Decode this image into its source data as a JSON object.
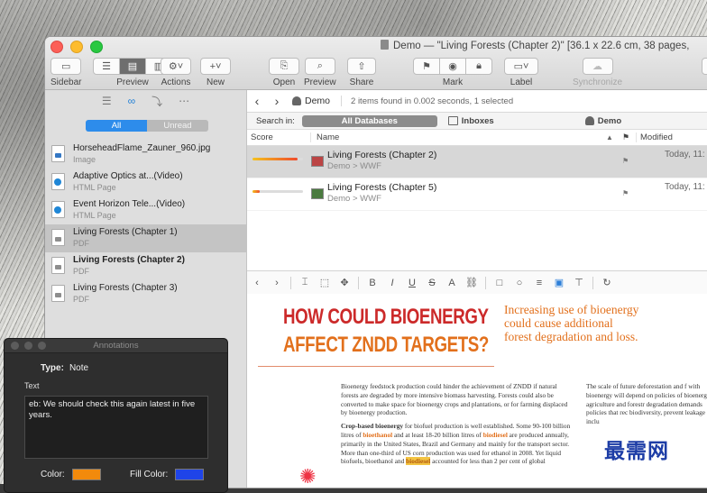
{
  "window": {
    "title": "Demo — \"Living Forests (Chapter 2)\" [36.1 x 22.6 cm, 38 pages,",
    "colors": {
      "accent": "#2d8ceb"
    }
  },
  "toolbar": {
    "sidebar": "Sidebar",
    "preview": "Preview",
    "actions": "Actions",
    "new": "New",
    "open": "Open",
    "preview2": "Preview",
    "share": "Share",
    "mark": "Mark",
    "label": "Label",
    "synchronize": "Synchronize"
  },
  "sidebar": {
    "filter": {
      "all": "All",
      "unread": "Unread"
    },
    "items": [
      {
        "name": "HorseheadFlame_Zauner_960.jpg",
        "kind": "Image",
        "icon": "image-icon"
      },
      {
        "name": "Adaptive Optics at...(Video)",
        "kind": "HTML Page",
        "icon": "web-icon"
      },
      {
        "name": "Event Horizon Tele...(Video)",
        "kind": "HTML Page",
        "icon": "web-icon"
      },
      {
        "name": "Living Forests (Chapter 1)",
        "kind": "PDF",
        "icon": "pdf-icon"
      },
      {
        "name": "Living Forests (Chapter 2)",
        "kind": "PDF",
        "icon": "pdf-icon"
      },
      {
        "name": "Living Forests (Chapter 3)",
        "kind": "PDF",
        "icon": "pdf-icon"
      }
    ]
  },
  "nav": {
    "database": "Demo",
    "found": "2 items found in 0.002 seconds, 1 selected"
  },
  "search_in": {
    "label": "Search in:",
    "all_databases": "All Databases",
    "inboxes": "Inboxes",
    "demo": "Demo"
  },
  "columns": {
    "score": "Score",
    "name": "Name",
    "modified": "Modified"
  },
  "results": [
    {
      "title": "Living Forests (Chapter 2)",
      "path": "Demo > WWF",
      "modified": "Today, 11:",
      "score": 0.9
    },
    {
      "title": "Living Forests (Chapter 5)",
      "path": "Demo > WWF",
      "modified": "Today, 11:",
      "score": 0.15
    }
  ],
  "document": {
    "headline1": "HOW COULD BIOENERGY",
    "headline2": "AFFECT ZNDD TARGETS?",
    "pullquote": "Increasing use of bioenergy could cause additional forest degradation and loss.",
    "para1": "Bioenergy feedstock production could hinder the achievement of ZNDD if natural forests are degraded by more intensive biomass harvesting. Forests could also be converted to make space for bioenergy crops and plantations, or for farming displaced by bioenergy production.",
    "p2_lead": "Crop-based bioenergy",
    "p2_a": " for biofuel production is well established. Some 90-100 billion litres of ",
    "bioethanol": "bioethanol",
    "p2_b": " and at least 18-20 billion litres of ",
    "biodiesel": "biodiesel",
    "p2_c": " are produced annually, primarily in the United States, Brazil and Germany and mainly for the transport sector. More than one-third of US corn production was used for ethanol in 2008. Yet liquid biofuels, bioethanol and ",
    "biodiesel2": "biodiesel",
    "p2_d": " accounted for less than 2 per cent of global",
    "col2": "The scale of future deforestation and f with bioenergy will depend on policies of bioenergy in agriculture and forestr degradation demands policies that rec biodiversity, prevent leakage and inclu",
    "watermark": "最需网"
  },
  "annotations": {
    "title": "Annotations",
    "type_label": "Type:",
    "type_value": "Note",
    "text_label": "Text",
    "text": "eb: We should check this again latest in five years.",
    "color_label": "Color:",
    "fill_label": "Fill Color:",
    "color": "#f28a0c",
    "fill_color": "#1f44e8"
  }
}
